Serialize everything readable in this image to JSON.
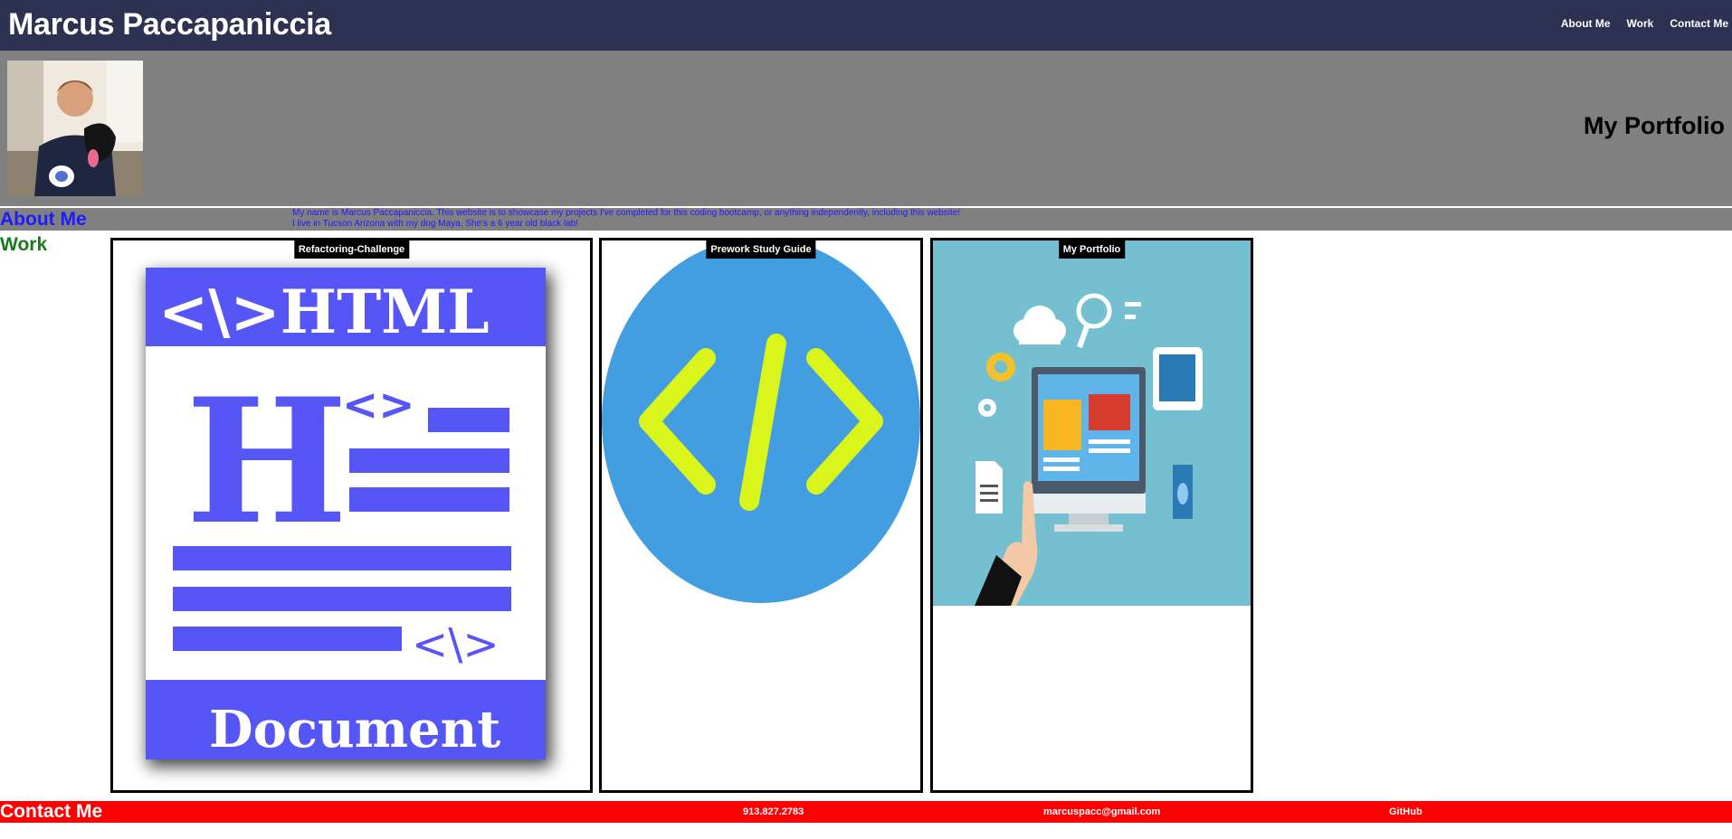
{
  "header": {
    "title": "Marcus Paccapaniccia",
    "nav": [
      "About Me",
      "Work",
      "Contact Me"
    ]
  },
  "hero": {
    "title": "My Portfolio"
  },
  "about": {
    "heading": "About Me",
    "line1": "My name is Marcus Paccapaniccia. This website is to showcase my projects I've completed for this coding bootcamp, or anything independently, including this website!",
    "line2": "I live in Tucson Arizona with my dog Maya. She's a 6 year old black lab!"
  },
  "work": {
    "heading": "Work",
    "cards": [
      {
        "label": "Refactoring-Challenge",
        "image": "html-document-icon"
      },
      {
        "label": "Prework Study Guide",
        "image": "code-brackets-icon"
      },
      {
        "label": "My Portfolio",
        "image": "web-development-illustration"
      }
    ]
  },
  "footer": {
    "heading": "Contact Me",
    "phone": "913.827.2783",
    "email": "marcuspacc@gmail.com",
    "github": "GitHub"
  },
  "colors": {
    "header_bg": "#2e3252",
    "hero_bg": "#808080",
    "about_text": "#1c1cff",
    "work_heading": "#1a7a1a",
    "footer_bg": "#ff0000"
  }
}
